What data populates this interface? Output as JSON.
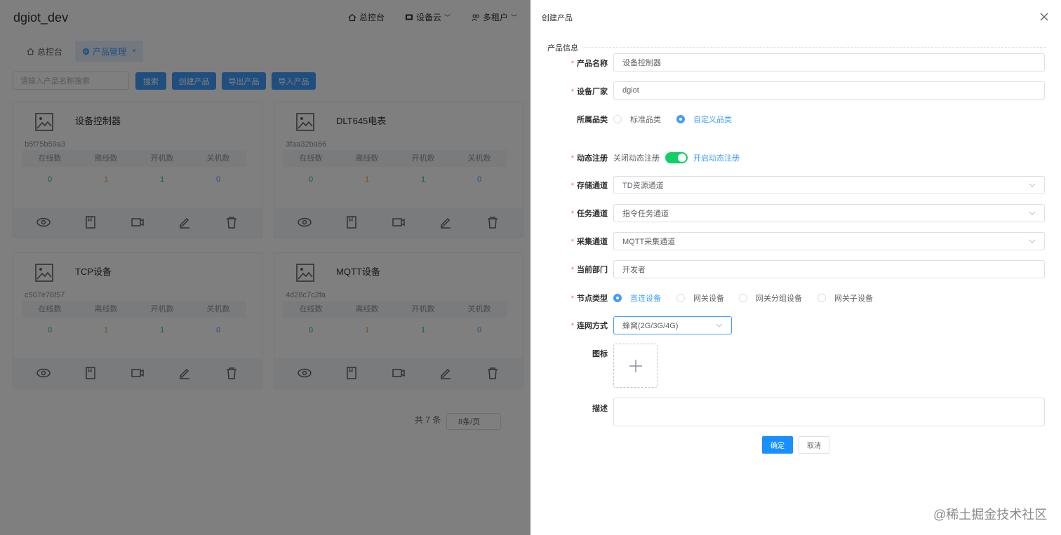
{
  "app": {
    "brand": "dgiot_dev",
    "nav": {
      "home": "总控台",
      "cloud": "设备云",
      "tenant": "多租户"
    },
    "tabs": [
      {
        "label": "总控台"
      },
      {
        "label": "产品管理"
      }
    ],
    "search_placeholder": "请输入产品名称搜索",
    "toolbar": {
      "search": "搜索",
      "create": "创建产品",
      "export": "导出产品",
      "import": "导入产品"
    },
    "stat_headers": [
      "在线数",
      "离线数",
      "开机数",
      "关机数"
    ],
    "products": [
      {
        "name": "设备控制器",
        "id": "b5f75b59a3",
        "online": "0",
        "offline": "1",
        "on": "1",
        "off": "0"
      },
      {
        "name": "DLT645电表",
        "id": "3faa32ba66",
        "online": "0",
        "offline": "1",
        "on": "1",
        "off": "0"
      },
      {
        "name": "TCP设备",
        "id": "c507e76f57",
        "online": "0",
        "offline": "1",
        "on": "1",
        "off": "0"
      },
      {
        "name": "MQTT设备",
        "id": "4d28c7c2fa",
        "online": "0",
        "offline": "1",
        "on": "1",
        "off": "0"
      }
    ],
    "pager": {
      "total": "共 7 条",
      "page_size": "8条/页"
    }
  },
  "drawer": {
    "title": "创建产品",
    "section": "产品信息",
    "fields": {
      "name": {
        "label": "产品名称",
        "value": "设备控制器"
      },
      "vendor": {
        "label": "设备厂家",
        "value": "dgiot"
      },
      "category": {
        "label": "所属品类",
        "options": [
          "标准品类",
          "自定义品类"
        ],
        "selected": "自定义品类"
      },
      "dynreg": {
        "label": "动态注册",
        "off_text": "关闭动态注册",
        "on_text": "开启动态注册",
        "enabled": true
      },
      "storage": {
        "label": "存储通道",
        "value": "TD资源通道"
      },
      "task": {
        "label": "任务通道",
        "value": "指令任务通道"
      },
      "collect": {
        "label": "采集通道",
        "value": "MQTT采集通道"
      },
      "dept": {
        "label": "当前部门",
        "value": "开发者"
      },
      "nodetype": {
        "label": "节点类型",
        "options": [
          "直连设备",
          "网关设备",
          "网关分组设备",
          "网关子设备"
        ],
        "selected": "直连设备"
      },
      "network": {
        "label": "连网方式",
        "value": "蜂窝(2G/3G/4G)"
      },
      "icon": {
        "label": "图标"
      },
      "desc": {
        "label": "描述"
      }
    },
    "buttons": {
      "confirm": "确定",
      "cancel": "取消"
    }
  },
  "watermark": "@稀土掘金技术社区",
  "colors": {
    "primary": "#409eff",
    "switch_on": "#13ce66",
    "required": "#f56c6c",
    "overlay": "rgba(0,0,0,0.5)"
  }
}
